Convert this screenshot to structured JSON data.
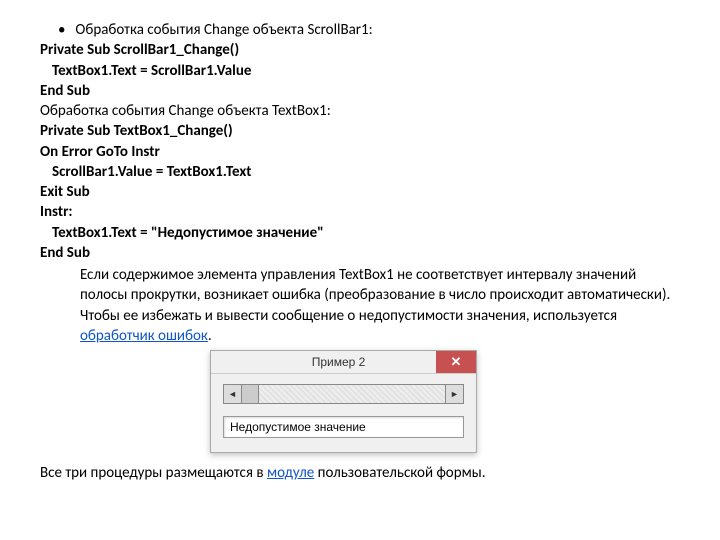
{
  "lines": {
    "l1": "Обработка события Change объекта ScrollBar1:",
    "l2": "Private Sub ScrollBar1_Change()",
    "l3": "TextBox1.Text = ScrollBar1.Value",
    "l4": "End Sub",
    "l5": "Обработка события Change объекта TextBox1:",
    "l6": "Private Sub TextBox1_Change()",
    "l7": "On Error GoTo Instr",
    "l8": "ScrollBar1.Value = TextBox1.Text",
    "l9": "Exit Sub",
    "l10": "Instr:",
    "l11a": "TextBox1.Text = \"",
    "l11b": "Недопустимое значение",
    "l11c": "\"",
    "l12": "End Sub"
  },
  "para1_a": "Если содержимое элемента управления TextBox1 не соответствует интервалу значений полосы прокрутки, возникает ошибка (преобразование в число происходит автоматически). Чтобы ее избежать и вывести сообщение о недопустимости значения, используется ",
  "para1_link": "обработчик ошибок",
  "para1_b": ".",
  "window": {
    "title": "Пример 2",
    "textbox_value": "Недопустимое значение"
  },
  "bottom_a": "Все три процедуры размещаются в ",
  "bottom_link": "модуле",
  "bottom_b": " пользовательской формы.",
  "glyphs": {
    "bullet": "•",
    "close": "✕",
    "tri_left": "◄",
    "tri_right": "►"
  }
}
